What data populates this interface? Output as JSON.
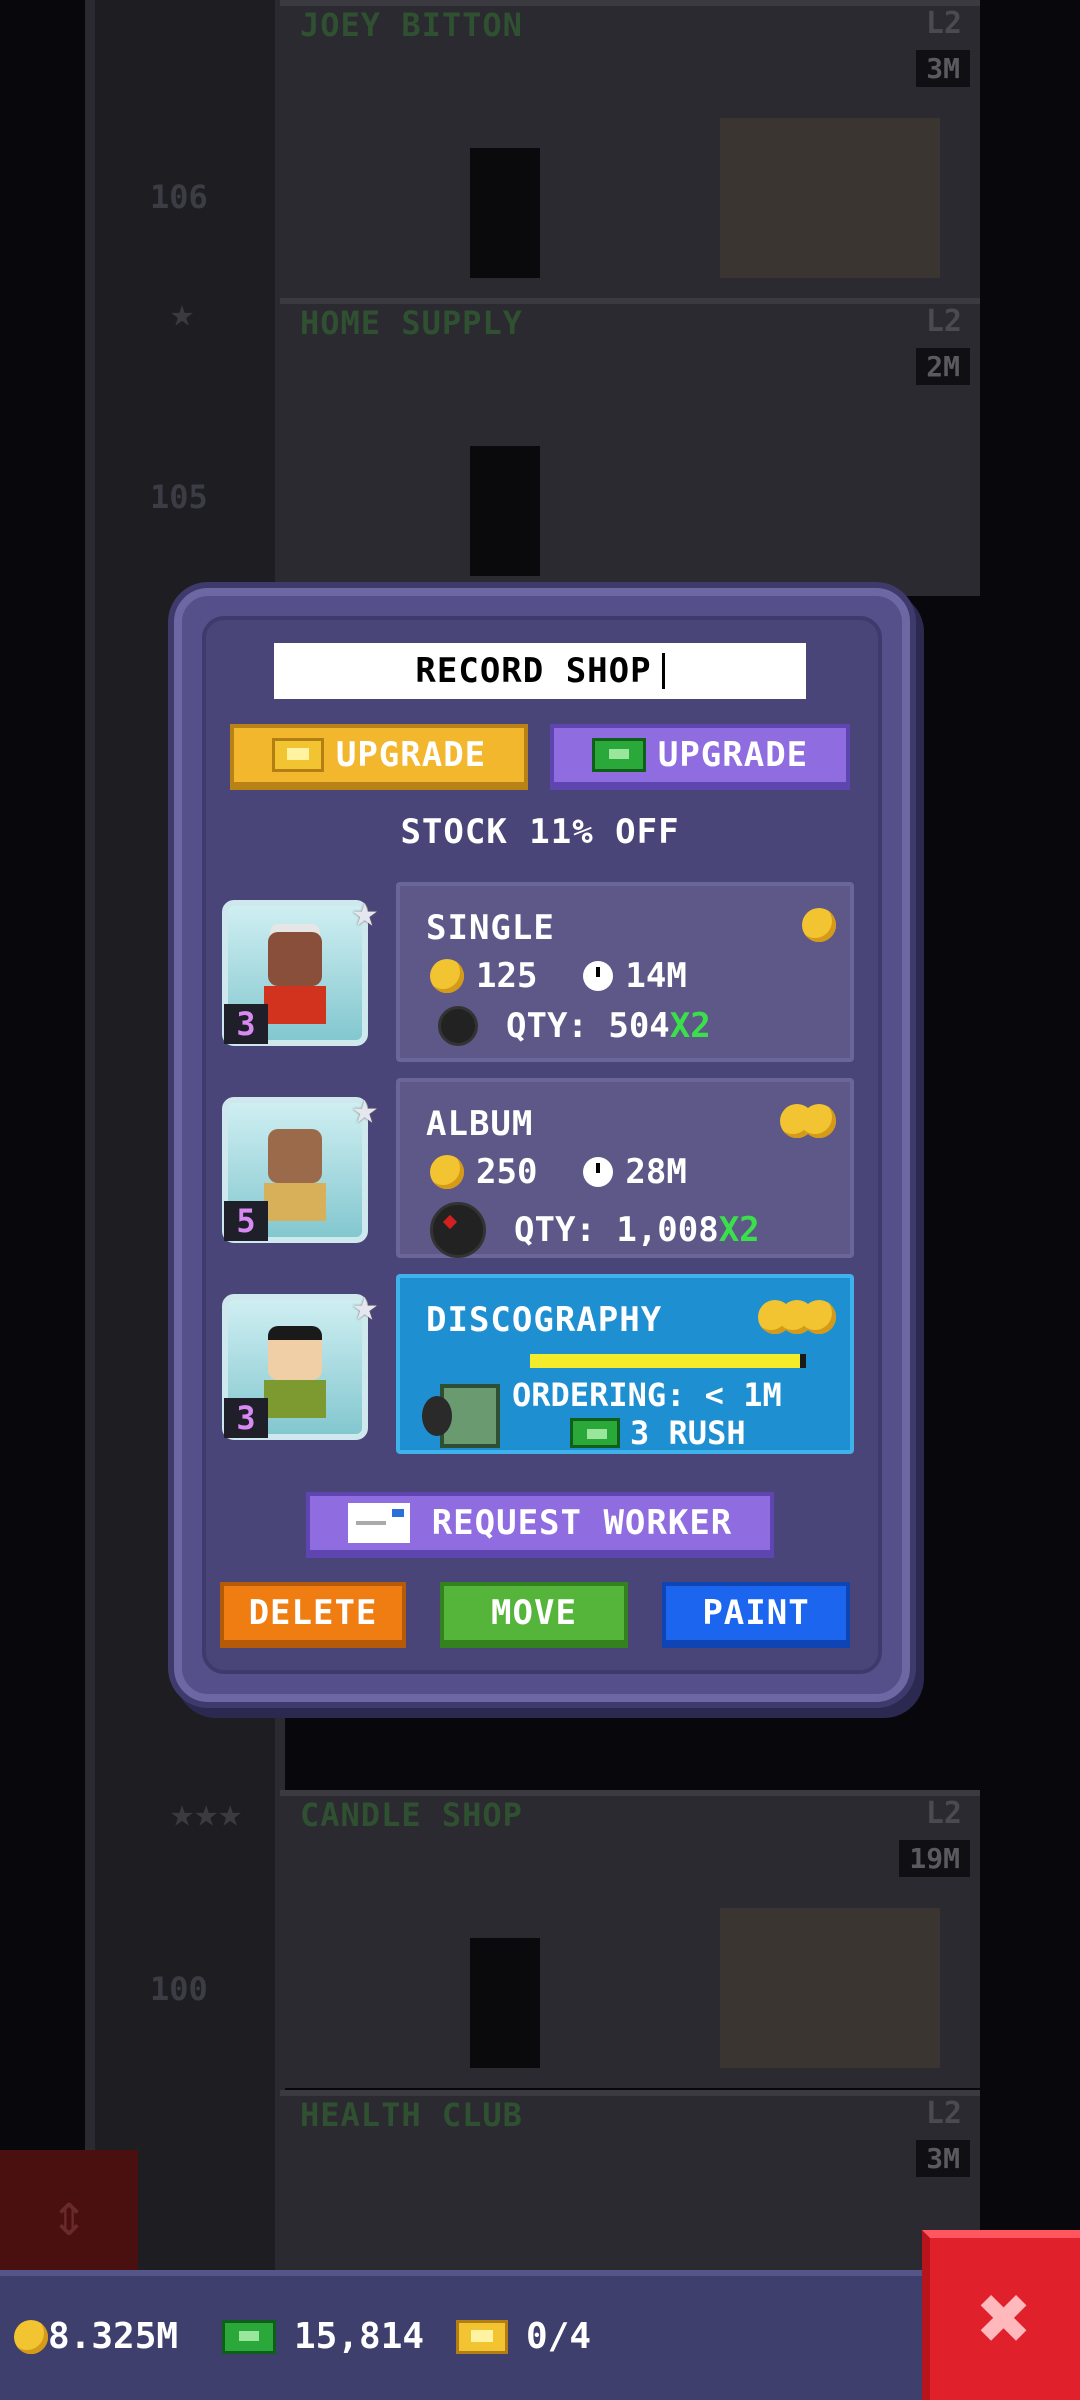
{
  "background": {
    "floors": [
      {
        "name": "JOEY BITTON",
        "level": "L2",
        "badge": "3M",
        "number": "106"
      },
      {
        "name": "HOME SUPPLY",
        "level": "L2",
        "badge": "2M",
        "number": "105"
      },
      {
        "name": "CANDLE SHOP",
        "level": "L2",
        "badge": "19M",
        "number": "100"
      },
      {
        "name": "HEALTH CLUB",
        "level": "L2",
        "badge": "3M",
        "number": ""
      }
    ]
  },
  "modal": {
    "title_value": "RECORD SHOP",
    "upgrade_gold_label": "UPGRADE",
    "upgrade_bux_label": "UPGRADE",
    "stock_discount": "STOCK 11% OFF",
    "workers": [
      {
        "level": "3",
        "shirt_color": "#d2331f",
        "skin_color": "#8a4f3a"
      },
      {
        "level": "5",
        "shirt_color": "#d9b05a",
        "skin_color": "#9a6a4a"
      },
      {
        "level": "3",
        "shirt_color": "#7c9a2f",
        "skin_color": "#f1cfa6"
      }
    ],
    "items": [
      {
        "name": "SINGLE",
        "cost": "125",
        "time": "14M",
        "qty_label": "QTY: 504",
        "multiplier": "X2"
      },
      {
        "name": "ALBUM",
        "cost": "250",
        "time": "28M",
        "qty_label": "QTY: 1,008",
        "multiplier": "X2"
      },
      {
        "name": "DISCOGRAPHY",
        "ordering": "ORDERING: < 1M",
        "rush": "3 RUSH",
        "progress": 0.98
      }
    ],
    "request_worker_label": "REQUEST WORKER",
    "delete_label": "DELETE",
    "move_label": "MOVE",
    "paint_label": "PAINT"
  },
  "bottom_bar": {
    "coins": "8.325M",
    "bux": "15,814",
    "tickets": "0/4"
  },
  "colors": {
    "modal_bg": "#55508a",
    "active_item": "#1e8fd0",
    "close_button": "#e0202a"
  }
}
